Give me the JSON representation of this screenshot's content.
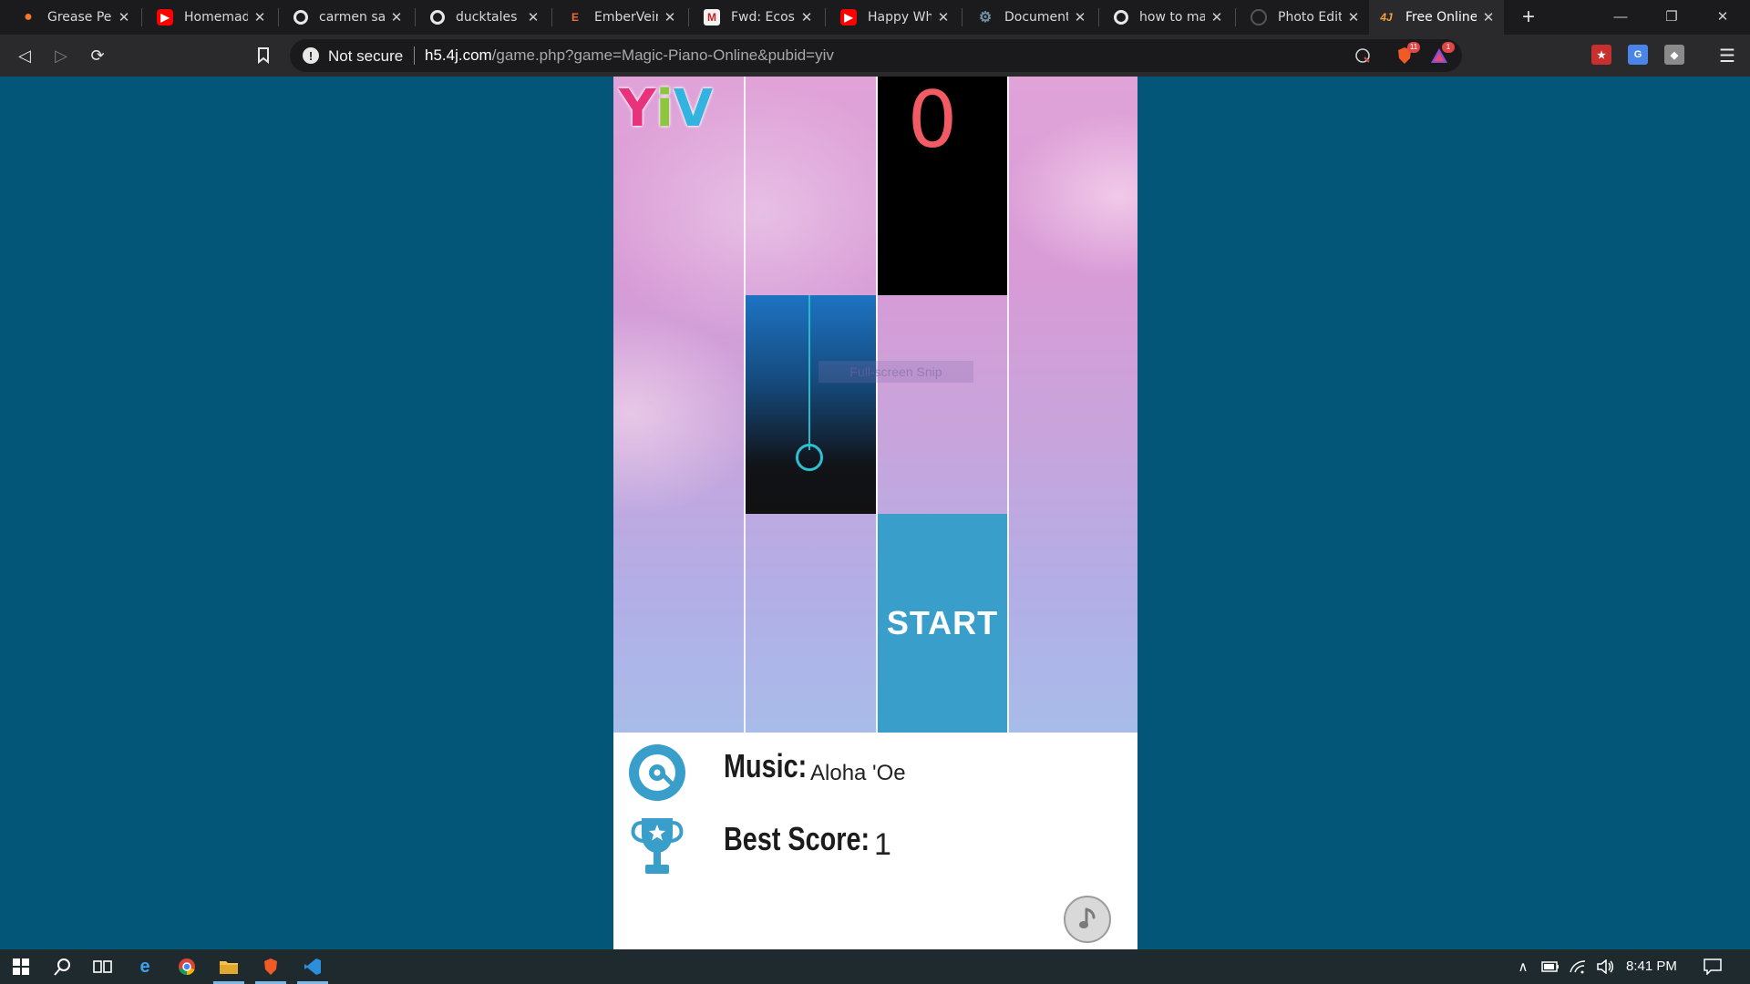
{
  "browser": {
    "tabs": [
      {
        "title": "Grease Penc",
        "icon": "blender-icon",
        "active": false
      },
      {
        "title": "Homemade",
        "icon": "youtube-icon",
        "active": false
      },
      {
        "title": "carmen san",
        "icon": "google-icon",
        "active": false
      },
      {
        "title": "ducktales -",
        "icon": "google-icon",
        "active": false
      },
      {
        "title": "EmberVein",
        "icon": "embervein-icon",
        "active": false
      },
      {
        "title": "Fwd: Ecosia",
        "icon": "gmail-icon",
        "active": false
      },
      {
        "title": "Happy Whe",
        "icon": "youtube-icon",
        "active": false
      },
      {
        "title": "Documenta",
        "icon": "gear-icon",
        "active": false
      },
      {
        "title": "how to mak",
        "icon": "google-icon",
        "active": false
      },
      {
        "title": "Photo Edito",
        "icon": "photo-editor-icon",
        "active": false
      },
      {
        "title": "Free Online",
        "icon": "4j-icon",
        "active": true
      }
    ],
    "security_label": "Not secure",
    "url_host": "h5.4j.com",
    "url_path": "/game.php?game=Magic-Piano-Online&pubid=yiv",
    "brave_shield_count": "11",
    "rewards_badge": "1"
  },
  "game": {
    "logo_letters": [
      "Y",
      "i",
      "V"
    ],
    "logo_colors": [
      "#e8327c",
      "#8cc63f",
      "#33b4e0"
    ],
    "score": "0",
    "start_label": "START",
    "overlay_text": "Full-screen Snip"
  },
  "info": {
    "music_label": "Music:",
    "music_value": "Aloha 'Oe",
    "best_label": "Best Score:",
    "best_value": "1"
  },
  "taskbar": {
    "time": "8:41 PM"
  },
  "colors": {
    "page_background": "#045679",
    "accent_blue": "#399fca",
    "score_red": "#f25a64"
  }
}
